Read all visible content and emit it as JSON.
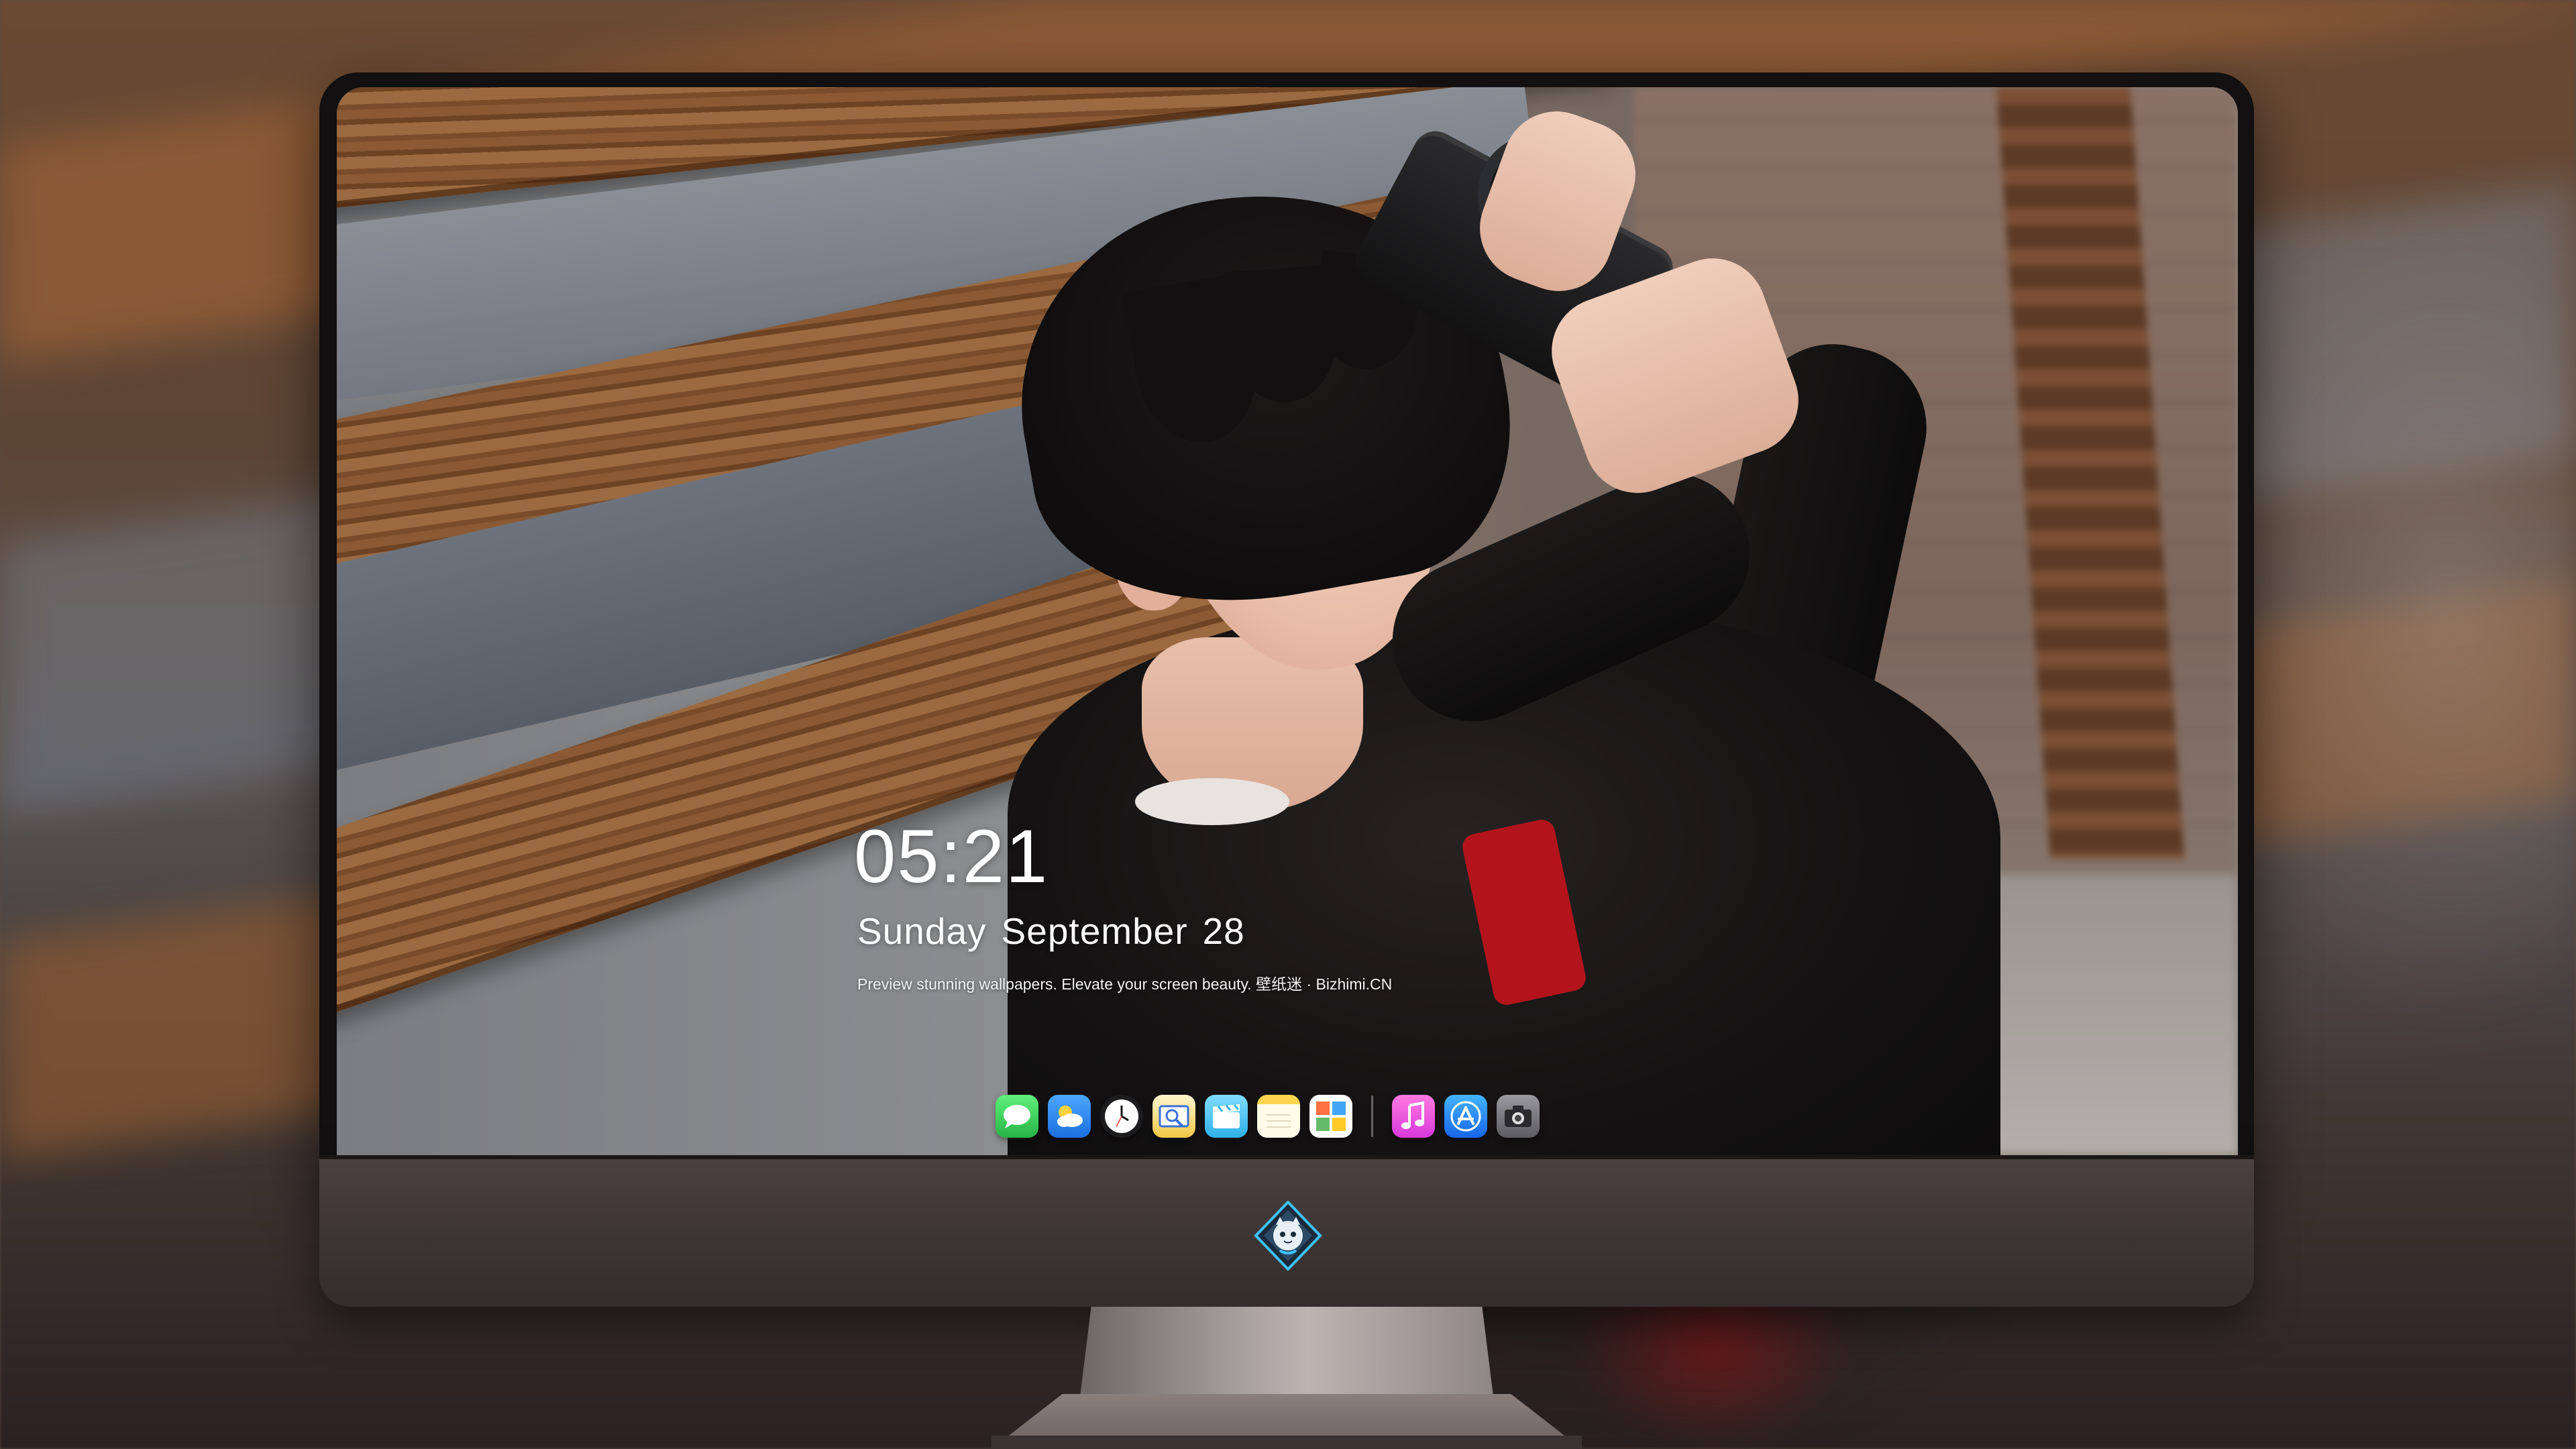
{
  "lock_screen": {
    "time": "05:21",
    "date": {
      "weekday": "Sunday",
      "month": "September",
      "day": "28"
    },
    "tagline": "Preview stunning wallpapers. Elevate your screen beauty. 壁纸迷 · Bizhimi.CN"
  },
  "dock": {
    "apps": [
      {
        "name": "Messages",
        "icon": "messages-icon",
        "color": "#34c759"
      },
      {
        "name": "Weather",
        "icon": "weather-icon",
        "color": "#1e90ff"
      },
      {
        "name": "Clock",
        "icon": "clock-icon",
        "color": "#1c1c1e"
      },
      {
        "name": "Preview",
        "icon": "preview-icon",
        "color": "#f2c744"
      },
      {
        "name": "Clips",
        "icon": "clips-icon",
        "color": "#4fc3f7"
      },
      {
        "name": "Notes",
        "icon": "notes-icon",
        "color": "#ffd54f"
      },
      {
        "name": "Photo Booth",
        "icon": "photo-collage-icon",
        "color": "#ffffff"
      },
      {
        "name": "Music",
        "icon": "music-icon",
        "color": "#fa4bd0"
      },
      {
        "name": "App Store",
        "icon": "app-store-icon",
        "color": "#1a8cff"
      },
      {
        "name": "Camera",
        "icon": "camera-icon",
        "color": "#6f6f72"
      }
    ]
  },
  "brand": {
    "logo": "bizhimi-mascot-logo"
  }
}
